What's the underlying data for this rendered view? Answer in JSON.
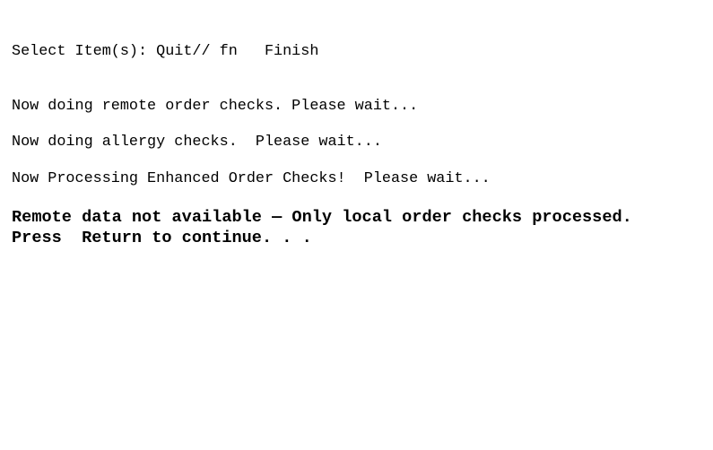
{
  "terminal": {
    "prompt_line": "Select Item(s): Quit// fn   Finish",
    "remote_checks_line": "Now doing remote order checks. Please wait...",
    "allergy_checks_line": "Now doing allergy checks.  Please wait...",
    "enhanced_checks_line": "Now Processing Enhanced Order Checks!  Please wait...",
    "warning_line": "Remote data not available — Only local order checks processed.",
    "continue_prompt": "Press  Return to continue. . ."
  },
  "colors": {
    "background": "#ffffff",
    "text": "#000000"
  }
}
